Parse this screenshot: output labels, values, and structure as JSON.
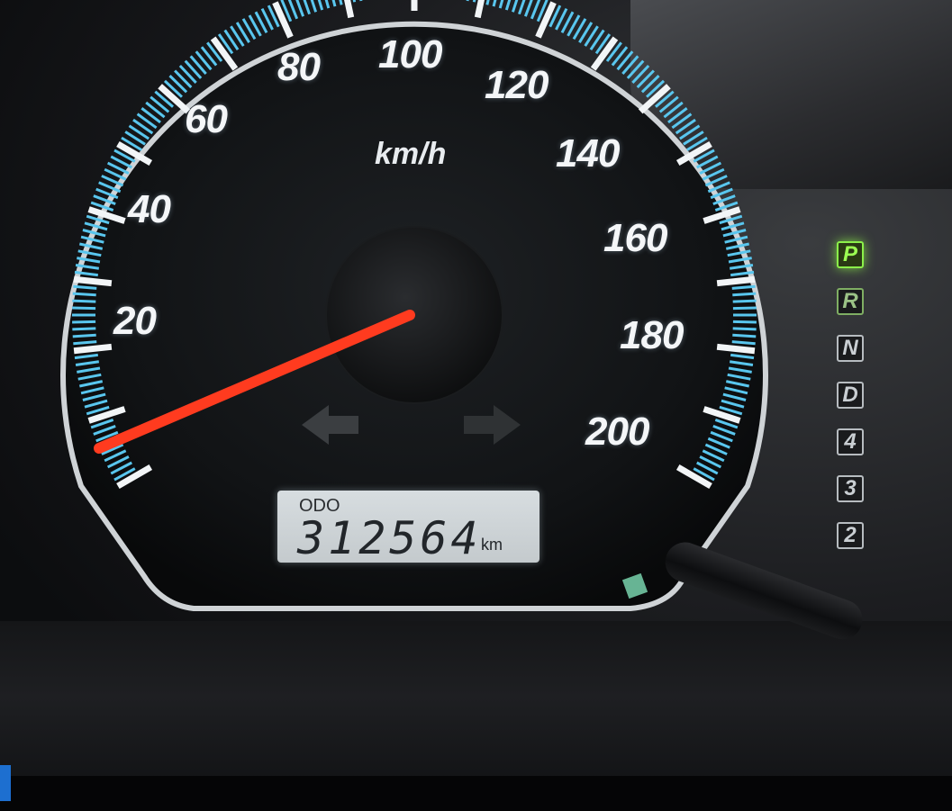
{
  "gauge": {
    "unit": "km/h",
    "scale_labels": [
      "20",
      "40",
      "60",
      "80",
      "100",
      "120",
      "140",
      "160",
      "180",
      "200"
    ],
    "scale_max": 200,
    "needle_value": 0,
    "colors": {
      "tick_color": "#59c6ee",
      "needle_color": "#ff3b1f",
      "label_color": "#f4f6f8",
      "bezel_color": "#c8ccd0"
    }
  },
  "odometer": {
    "title": "ODO",
    "value": "312564",
    "unit": "km"
  },
  "gear_indicator": {
    "gears": [
      "P",
      "R",
      "N",
      "D",
      "4",
      "3",
      "2"
    ],
    "selected": "P",
    "colors": {
      "active": "#9cff52",
      "inactive": "#c9ced2"
    }
  },
  "turn_signals": {
    "left_icon": "left-arrow-icon",
    "right_icon": "right-arrow-icon"
  }
}
